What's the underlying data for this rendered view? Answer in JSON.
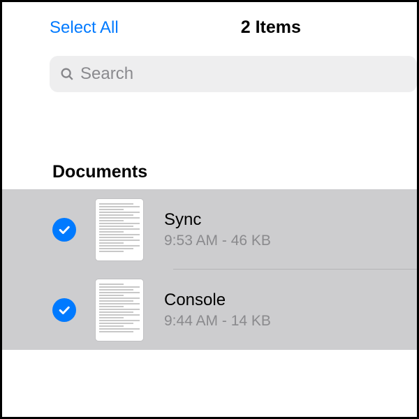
{
  "header": {
    "select_all_label": "Select All",
    "title": "2 Items"
  },
  "search": {
    "placeholder": "Search",
    "value": ""
  },
  "section": {
    "title": "Documents"
  },
  "files": [
    {
      "name": "Sync",
      "subtitle": "9:53 AM - 46 KB",
      "selected": true
    },
    {
      "name": "Console",
      "subtitle": "9:44 AM - 14 KB",
      "selected": true
    }
  ]
}
